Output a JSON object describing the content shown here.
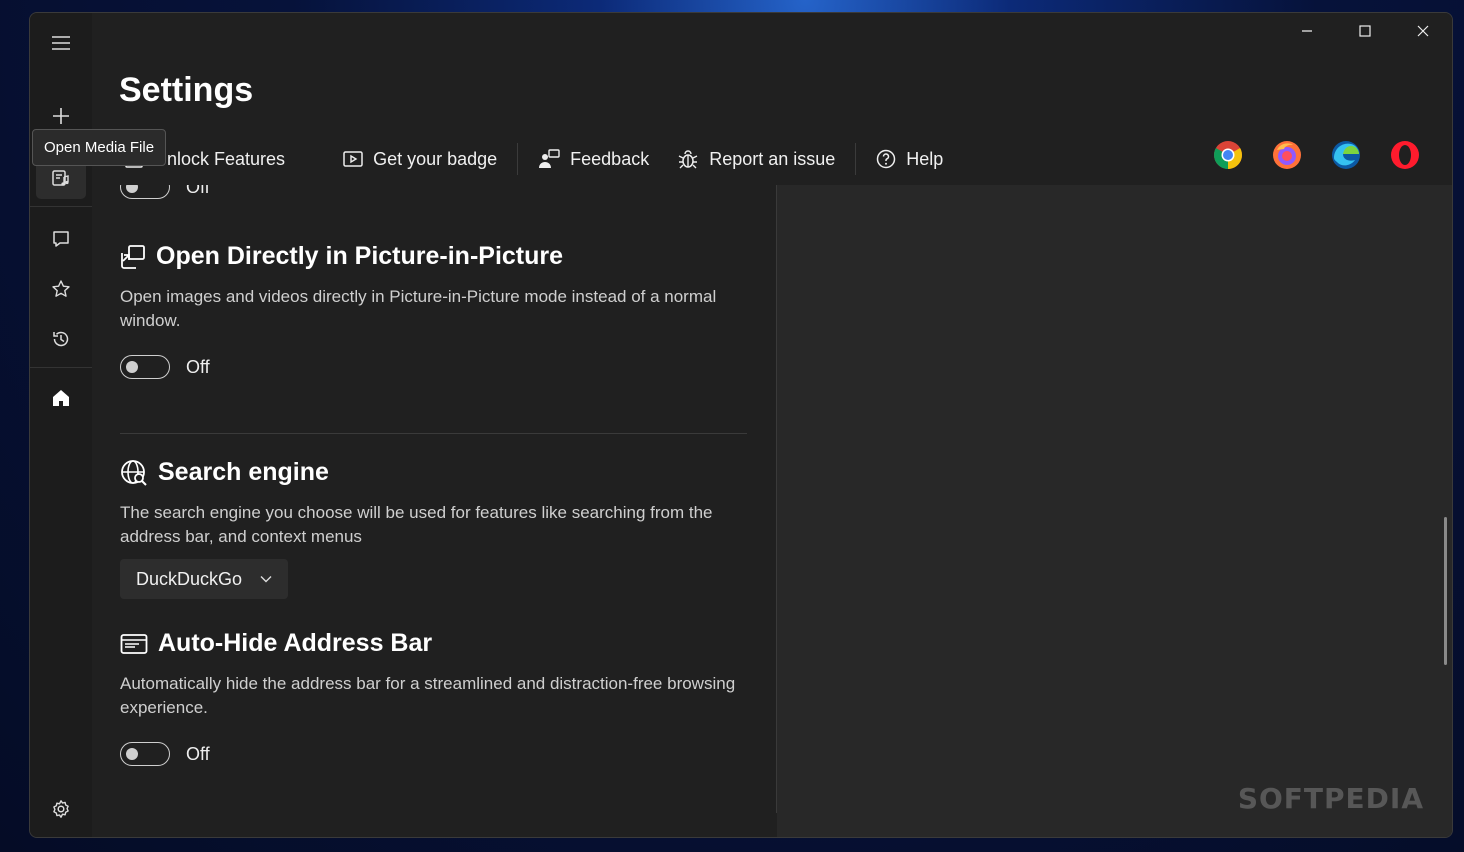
{
  "window": {
    "title": "Settings",
    "controls": {
      "minimize_icon": "minimize-icon",
      "maximize_icon": "maximize-icon",
      "close_icon": "close-icon"
    }
  },
  "rail": {
    "tooltip": "Open Media File",
    "items": [
      {
        "icon": "hamburger-menu-icon"
      },
      {
        "icon": "plus-icon"
      },
      {
        "icon": "media-file-icon"
      },
      {
        "icon": "chat-icon"
      },
      {
        "icon": "star-icon"
      },
      {
        "icon": "history-icon"
      },
      {
        "icon": "home-icon"
      },
      {
        "icon": "gear-icon"
      }
    ]
  },
  "toolbar": {
    "unlock": "Unlock Features",
    "badge": "Get your badge",
    "feedback": "Feedback",
    "report": "Report an issue",
    "help": "Help"
  },
  "browsers": [
    "Chrome",
    "Firefox",
    "Edge",
    "Opera"
  ],
  "sections": {
    "top_toggle_state": "Off",
    "pip": {
      "title": "Open Directly in Picture-in-Picture",
      "desc": "Open images and videos directly in Picture-in-Picture mode instead of a normal window.",
      "state": "Off"
    },
    "search": {
      "title": "Search engine",
      "desc": "The search engine you choose will be used for features like searching from the address bar, and context menus",
      "selected": "DuckDuckGo"
    },
    "autohide": {
      "title": "Auto-Hide Address Bar",
      "desc": "Automatically hide the address bar for a streamlined and distraction-free browsing experience.",
      "state": "Off"
    }
  },
  "watermark": "SOFTPEDIA",
  "colors": {
    "window_bg": "#202020",
    "rail_bg": "#1c1c1c",
    "right_pane": "#282828"
  }
}
